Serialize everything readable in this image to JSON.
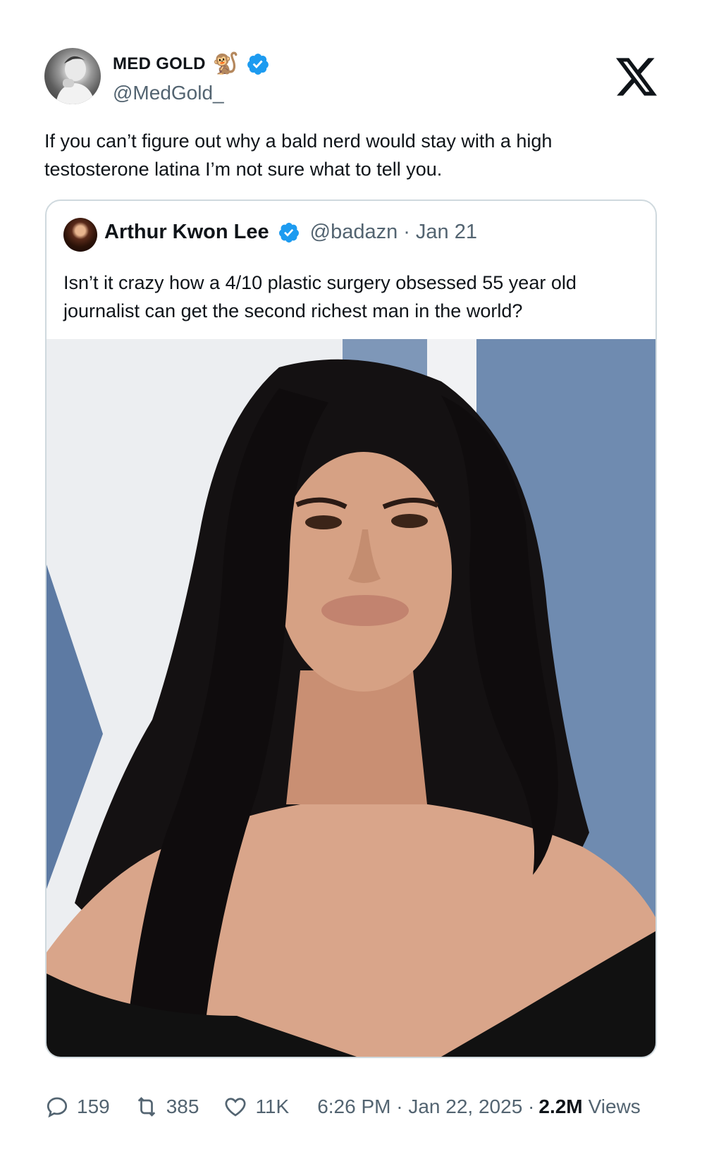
{
  "author": {
    "name": "MED GOLD",
    "name_emoji": "🐒",
    "handle": "@MedGold_",
    "verified": true
  },
  "brand": {
    "logo_icon": "x-logo-icon"
  },
  "tweet": {
    "text": "If you can’t figure out why a bald nerd would stay with a high testosterone latina I’m not sure what to tell you."
  },
  "quoted": {
    "name": "Arthur Kwon Lee",
    "handle": "@badazn",
    "separator": "·",
    "date": "Jan 21",
    "verified": true,
    "text": "Isn’t it crazy how a 4/10 plastic surgery obsessed 55 year old journalist can get the second richest man in the world?"
  },
  "footer": {
    "replies": "159",
    "retweets": "385",
    "likes": "11K",
    "timestamp": "6:26 PM · Jan 22, 2025 ·",
    "views_count": "2.2M",
    "views_label": "Views"
  },
  "colors": {
    "verified_blue": "#1d9bf0",
    "text_primary": "#0f1419",
    "text_secondary": "#536471",
    "border": "#cfd9de"
  }
}
